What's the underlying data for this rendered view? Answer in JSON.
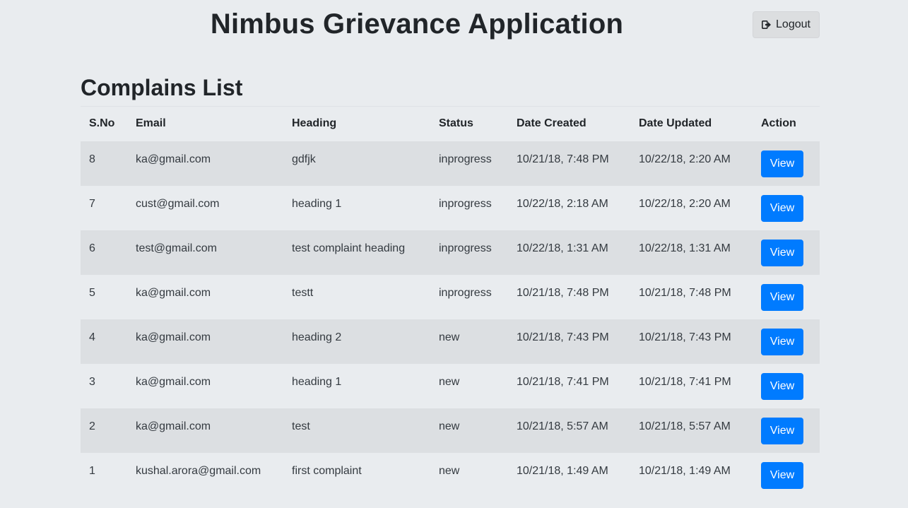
{
  "app": {
    "title": "Nimbus Grievance Application",
    "logout_label": "Logout",
    "logout_icon": "sign-out-icon"
  },
  "section": {
    "title": "Complains List"
  },
  "table": {
    "columns": [
      "S.No",
      "Email",
      "Heading",
      "Status",
      "Date Created",
      "Date Updated",
      "Action"
    ],
    "rows": [
      {
        "sno": "8",
        "email": "ka@gmail.com",
        "heading": "gdfjk",
        "status": "inprogress",
        "created": "10/21/18, 7:48 PM",
        "updated": "10/22/18, 2:20 AM",
        "action": "View"
      },
      {
        "sno": "7",
        "email": "cust@gmail.com",
        "heading": "heading 1",
        "status": "inprogress",
        "created": "10/22/18, 2:18 AM",
        "updated": "10/22/18, 2:20 AM",
        "action": "View"
      },
      {
        "sno": "6",
        "email": "test@gmail.com",
        "heading": "test complaint heading",
        "status": "inprogress",
        "created": "10/22/18, 1:31 AM",
        "updated": "10/22/18, 1:31 AM",
        "action": "View"
      },
      {
        "sno": "5",
        "email": "ka@gmail.com",
        "heading": "testt",
        "status": "inprogress",
        "created": "10/21/18, 7:48 PM",
        "updated": "10/21/18, 7:48 PM",
        "action": "View"
      },
      {
        "sno": "4",
        "email": "ka@gmail.com",
        "heading": "heading 2",
        "status": "new",
        "created": "10/21/18, 7:43 PM",
        "updated": "10/21/18, 7:43 PM",
        "action": "View"
      },
      {
        "sno": "3",
        "email": "ka@gmail.com",
        "heading": "heading 1",
        "status": "new",
        "created": "10/21/18, 7:41 PM",
        "updated": "10/21/18, 7:41 PM",
        "action": "View"
      },
      {
        "sno": "2",
        "email": "ka@gmail.com",
        "heading": "test",
        "status": "new",
        "created": "10/21/18, 5:57 AM",
        "updated": "10/21/18, 5:57 AM",
        "action": "View"
      },
      {
        "sno": "1",
        "email": "kushal.arora@gmail.com",
        "heading": "first complaint",
        "status": "new",
        "created": "10/21/18, 1:49 AM",
        "updated": "10/21/18, 1:49 AM",
        "action": "View"
      }
    ]
  },
  "colors": {
    "background": "#e9ecef",
    "stripe": "#dcdfe2",
    "primary": "#007bff",
    "logout_bg": "#dcdee0"
  }
}
